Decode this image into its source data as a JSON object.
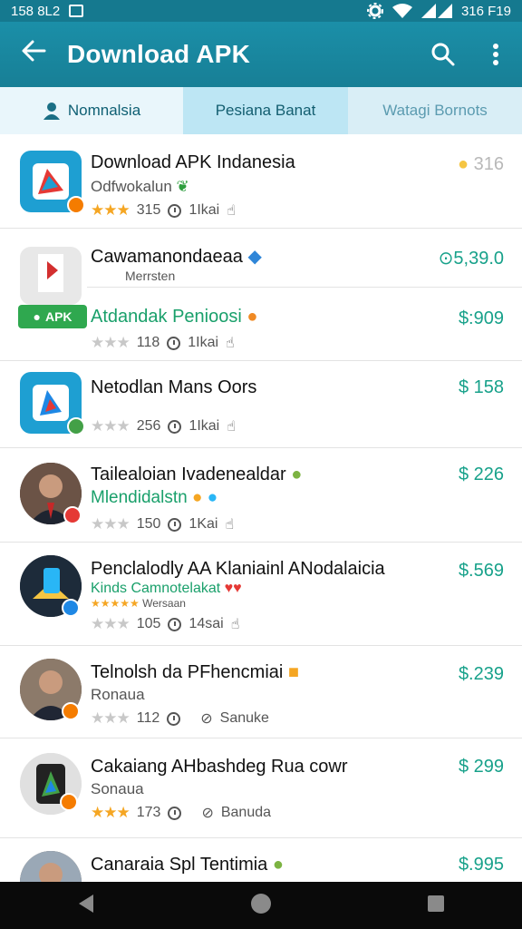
{
  "status_bar": {
    "time": "158 8L2",
    "right": "316 F19"
  },
  "app_bar": {
    "title": "Download APK"
  },
  "tabs": [
    {
      "label": "Nomnalsia"
    },
    {
      "label": "Pesiana Banat"
    },
    {
      "label": "Watagi Bornots"
    }
  ],
  "items": [
    {
      "name": "Download APK Indanesia",
      "sub": "Odfwokalun",
      "rating_count": "315",
      "meta_b": "1Ikai",
      "price": "316"
    },
    {
      "name": "Cawamanondaeaa",
      "sub": "Merrsten",
      "sub2": "Atdandak Penioosi",
      "tag": "APK",
      "rating_count": "118",
      "meta_b": "1Ikai",
      "price": "5,39.0",
      "price2": "$:909"
    },
    {
      "name": "Netodlan Mans Oors",
      "rating_count": "256",
      "meta_b": "1Ikai",
      "price": "$ 158"
    },
    {
      "name": "Tailealoian Ivadenealdar",
      "sub": "Mlendidalstn",
      "rating_count": "150",
      "meta_b": "1Kai",
      "price": "$ 226"
    },
    {
      "name": "Penclalodly AA Klaniainl ANodalaicia",
      "sub": "Kinds Camnotelakat",
      "sub_b": "Wersaan",
      "rating_count": "105",
      "meta_b": "14sai",
      "price": "$.569"
    },
    {
      "name": "Telnolsh da PFhencmiai",
      "sub": "Ronaua",
      "rating_count": "112",
      "meta_b": "Sanuke",
      "price": "$.239"
    },
    {
      "name": "Cakaiang AHbashdeg Rua cowr",
      "sub": "Sonaua",
      "rating_count": "173",
      "meta_b": "Banuda",
      "price": "$ 299"
    },
    {
      "name": "Canaraia Spl Tentimia",
      "price": "$.995"
    }
  ],
  "colors": {
    "primary": "#1b8fa8",
    "price": "#17a18a",
    "star": "#f5a623",
    "apk_tag": "#2fa84f"
  }
}
